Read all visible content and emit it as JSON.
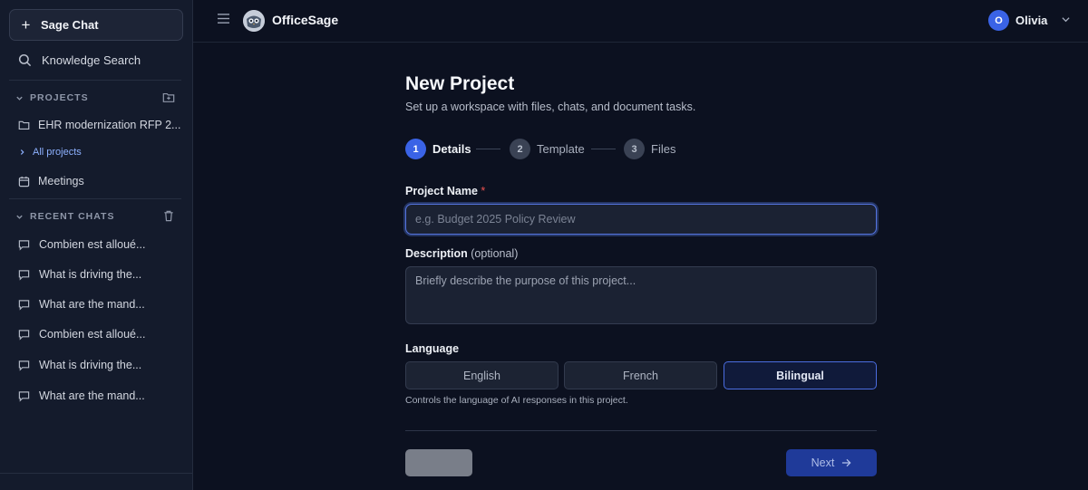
{
  "sidebar": {
    "sage_chat_label": "Sage Chat",
    "knowledge_search_label": "Knowledge Search",
    "projects_heading": "PROJECTS",
    "project_item": "EHR modernization RFP 2...",
    "all_projects_label": "All projects",
    "meetings_label": "Meetings",
    "recent_chats_heading": "RECENT CHATS",
    "chats": [
      "Combien est alloué...",
      "What is driving the...",
      "What are the mand...",
      "Combien est alloué...",
      "What is driving the...",
      "What are the mand..."
    ]
  },
  "header": {
    "app_title": "OfficeSage",
    "user_initial": "O",
    "user_name": "Olivia"
  },
  "form": {
    "title": "New Project",
    "subtitle": "Set up a workspace with files, chats, and document tasks.",
    "steps": [
      {
        "number": "1",
        "label": "Details",
        "active": true
      },
      {
        "number": "2",
        "label": "Template",
        "active": false
      },
      {
        "number": "3",
        "label": "Files",
        "active": false
      }
    ],
    "project_name_label": "Project Name",
    "required_mark": "*",
    "project_name_value": "",
    "project_name_placeholder": "e.g. Budget 2025 Policy Review",
    "description_label": "Description",
    "description_optional": "(optional)",
    "description_value": "",
    "description_placeholder": "Briefly describe the purpose of this project...",
    "language_label": "Language",
    "language_options": [
      "English",
      "French",
      "Bilingual"
    ],
    "language_selected": "Bilingual",
    "language_helper": "Controls the language of AI responses in this project.",
    "back_label": "",
    "next_label": "Next"
  },
  "colors": {
    "accent": "#3a63e6",
    "background": "#0c1120",
    "sidebar": "#141b2c",
    "link": "#8db1ff",
    "required": "#ef5350"
  },
  "icons": {
    "sage_chat": "plus-icon",
    "knowledge_search": "search-icon",
    "project": "folder-icon",
    "add_project": "folder-plus-icon",
    "meetings": "calendar-icon",
    "delete_chats": "trash-icon",
    "chat": "chat-bubble-icon",
    "menu": "hamburger-icon",
    "user_menu": "chevron-down-icon",
    "next": "arrow-right-icon"
  }
}
